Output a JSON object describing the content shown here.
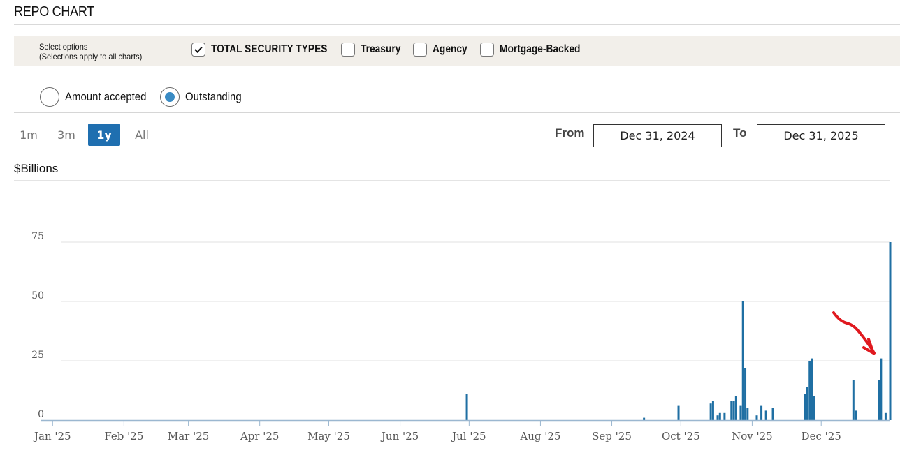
{
  "header": {
    "title": "REPO CHART"
  },
  "options": {
    "hint_line1": "Select options",
    "hint_line2": "(Selections apply to all charts)",
    "checkboxes": [
      {
        "label": "TOTAL SECURITY TYPES",
        "checked": true
      },
      {
        "label": "Treasury",
        "checked": false
      },
      {
        "label": "Agency",
        "checked": false
      },
      {
        "label": "Mortgage-Backed",
        "checked": false
      }
    ]
  },
  "measure": {
    "radios": [
      {
        "label": "Amount accepted",
        "selected": false
      },
      {
        "label": "Outstanding",
        "selected": true
      }
    ]
  },
  "range": {
    "buttons": [
      {
        "label": "1m",
        "active": false
      },
      {
        "label": "3m",
        "active": false
      },
      {
        "label": "1y",
        "active": true
      },
      {
        "label": "All",
        "active": false
      }
    ],
    "from_label": "From",
    "from_value": "Dec 31, 2024",
    "to_label": "To",
    "to_value": "Dec 31, 2025"
  },
  "chart_data": {
    "type": "bar",
    "title": "",
    "ylabel": "$Billions",
    "xlabel": "",
    "ylim": [
      0,
      75
    ],
    "yticks": [
      0,
      25,
      50,
      75
    ],
    "x_ticks": [
      {
        "date": "2025-01-01",
        "label": "Jan '25"
      },
      {
        "date": "2025-02-01",
        "label": "Feb '25"
      },
      {
        "date": "2025-03-01",
        "label": "Mar '25"
      },
      {
        "date": "2025-04-01",
        "label": "Apr '25"
      },
      {
        "date": "2025-05-01",
        "label": "May '25"
      },
      {
        "date": "2025-06-01",
        "label": "Jun '25"
      },
      {
        "date": "2025-07-01",
        "label": "Jul '25"
      },
      {
        "date": "2025-08-01",
        "label": "Aug '25"
      },
      {
        "date": "2025-09-01",
        "label": "Sep '25"
      },
      {
        "date": "2025-10-01",
        "label": "Oct '25"
      },
      {
        "date": "2025-11-01",
        "label": "Nov '25"
      },
      {
        "date": "2025-12-01",
        "label": "Dec '25"
      }
    ],
    "x_range": [
      "2024-12-31",
      "2025-12-31"
    ],
    "bar_color": "#1f6fa3",
    "grid": true,
    "points": [
      {
        "date": "2025-06-30",
        "value": 11
      },
      {
        "date": "2025-09-15",
        "value": 1
      },
      {
        "date": "2025-09-30",
        "value": 6
      },
      {
        "date": "2025-10-14",
        "value": 7
      },
      {
        "date": "2025-10-15",
        "value": 8
      },
      {
        "date": "2025-10-17",
        "value": 2
      },
      {
        "date": "2025-10-18",
        "value": 3
      },
      {
        "date": "2025-10-20",
        "value": 3
      },
      {
        "date": "2025-10-23",
        "value": 8
      },
      {
        "date": "2025-10-24",
        "value": 8
      },
      {
        "date": "2025-10-25",
        "value": 10
      },
      {
        "date": "2025-10-27",
        "value": 6
      },
      {
        "date": "2025-10-28",
        "value": 50
      },
      {
        "date": "2025-10-29",
        "value": 22
      },
      {
        "date": "2025-10-30",
        "value": 5
      },
      {
        "date": "2025-11-03",
        "value": 2
      },
      {
        "date": "2025-11-05",
        "value": 6
      },
      {
        "date": "2025-11-07",
        "value": 4
      },
      {
        "date": "2025-11-10",
        "value": 5
      },
      {
        "date": "2025-11-24",
        "value": 11
      },
      {
        "date": "2025-11-25",
        "value": 14
      },
      {
        "date": "2025-11-26",
        "value": 25
      },
      {
        "date": "2025-11-27",
        "value": 26
      },
      {
        "date": "2025-11-28",
        "value": 10
      },
      {
        "date": "2025-12-15",
        "value": 17
      },
      {
        "date": "2025-12-16",
        "value": 4
      },
      {
        "date": "2025-12-26",
        "value": 17
      },
      {
        "date": "2025-12-27",
        "value": 26
      },
      {
        "date": "2025-12-29",
        "value": 3
      },
      {
        "date": "2025-12-31",
        "value": 75
      }
    ]
  },
  "annotation": {
    "type": "hand-drawn arrow",
    "color": "#e0191f"
  }
}
